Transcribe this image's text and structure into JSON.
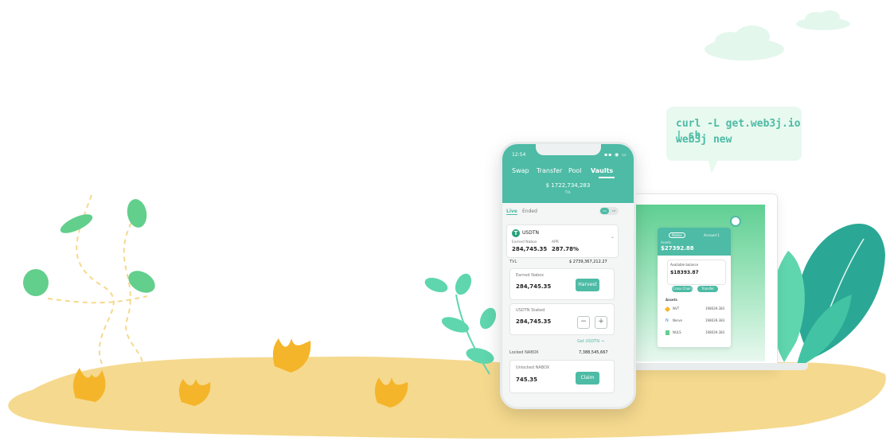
{
  "colors": {
    "accent": "#4dbba5",
    "sand": "#f5d98e",
    "plant": "#5fd6ae",
    "leaf_dark": "#2aa895",
    "flower": "#f5b52a",
    "cloud": "#e4f7ec"
  },
  "bubble": {
    "line1": "curl -L get.web3j.io | sh",
    "line2": "web3j new"
  },
  "phone": {
    "time": "12:54",
    "status": "▪▪ ◉ ▭",
    "tabs": [
      {
        "label": "Swap"
      },
      {
        "label": "Transfer"
      },
      {
        "label": "Pool"
      },
      {
        "label": "Vaults"
      }
    ],
    "tvl_value": "$ 1722,734,283",
    "tvl_label": "TVL",
    "filters": {
      "live": "Live",
      "ended": "Ended",
      "toggle_on": "On",
      "toggle_off": "Off"
    },
    "pool": {
      "token": "USDTN",
      "earned_label": "Earned Nabox",
      "earned_value": "284,745.35",
      "apr_label": "APR",
      "apr_value": "287.78%",
      "tvl_label": "TVL",
      "tvl_value": "$ 2739,367,212.27"
    },
    "earned_card": {
      "label": "Earned Nabox",
      "value": "284,745.35",
      "button": "Harvest"
    },
    "staked_card": {
      "label": "USDTN Staked",
      "value": "284,745.35",
      "minus": "−",
      "plus": "+"
    },
    "get_link": "Get USDTN →",
    "locked": {
      "label": "Locked NABOX",
      "value": "7,388,545,667"
    },
    "unlocked_card": {
      "label": "Unlocked NABOX",
      "value": "745.35",
      "button": "Claim"
    }
  },
  "laptop": {
    "badge": "Nabox",
    "account": "Account 1",
    "balance_label": "Assets",
    "balance": "$27392.88",
    "inner_label": "Available balance",
    "inner_value": "$18393.87",
    "btn1": "Cross Chain",
    "btn2": "Transfer",
    "assets_title": "Assets",
    "assets": [
      {
        "name": "NVT",
        "value": "198039.383"
      },
      {
        "name": "Nerve",
        "value": "198039.383"
      },
      {
        "name": "NULS",
        "value": "198039.383"
      }
    ]
  }
}
